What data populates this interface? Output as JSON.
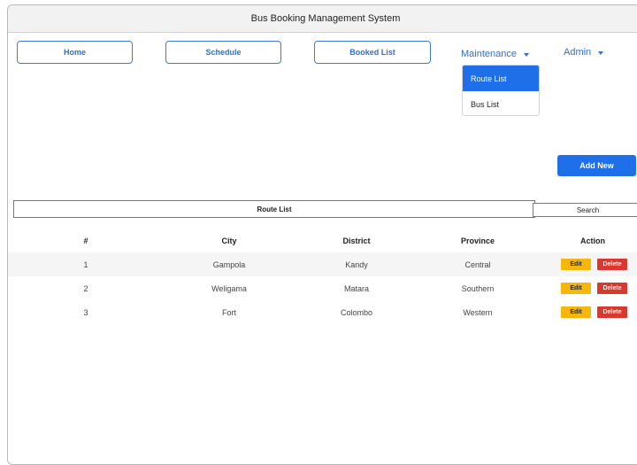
{
  "window": {
    "title": "Bus Booking Management System"
  },
  "nav": {
    "home": "Home",
    "schedule": "Schedule",
    "booked_list": "Booked List",
    "maintenance": "Maintenance",
    "admin": "Admin"
  },
  "maintenance_menu": {
    "items": [
      {
        "label": "Route List",
        "active": true
      },
      {
        "label": "Bus List",
        "active": false
      }
    ]
  },
  "actions": {
    "add_new": "Add New"
  },
  "route_list": {
    "title": "Route List",
    "search_label": "Search",
    "columns": [
      "#",
      "City",
      "District",
      "Province",
      "Action"
    ],
    "rows": [
      {
        "num": "1",
        "city": "Gampola",
        "district": "Kandy",
        "province": "Central"
      },
      {
        "num": "2",
        "city": "Weligama",
        "district": "Matara",
        "province": "Southern"
      },
      {
        "num": "3",
        "city": "Fort",
        "district": "Colombo",
        "province": "Western"
      }
    ],
    "edit_label": "Edit",
    "delete_label": "Delete"
  },
  "colors": {
    "primary": "#1f6fe8",
    "edit": "#f6b60b",
    "delete": "#d9382e"
  }
}
